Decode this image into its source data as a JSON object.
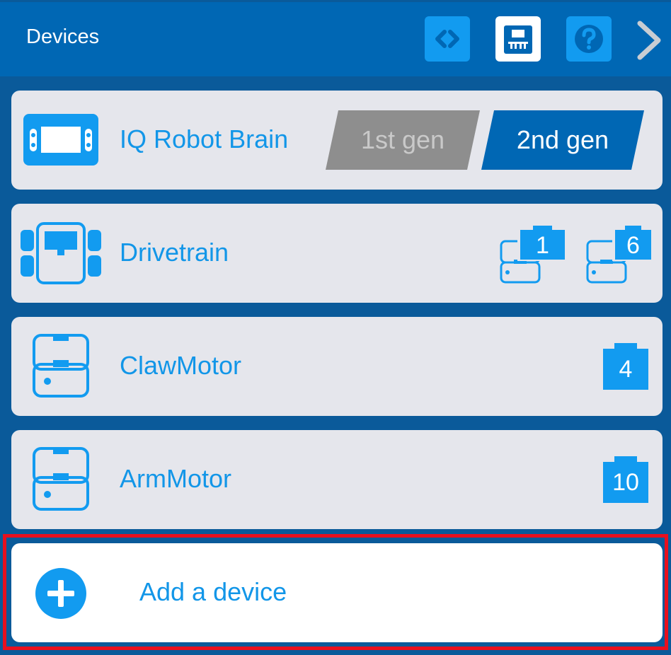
{
  "header": {
    "title": "Devices",
    "buttons": [
      {
        "icon": "code-icon",
        "active": false
      },
      {
        "icon": "devices-icon",
        "active": true
      },
      {
        "icon": "help-icon",
        "active": false
      }
    ],
    "next_icon": "chevron-right-icon"
  },
  "devices": [
    {
      "label": "IQ Robot Brain",
      "icon": "brain-icon",
      "generation": {
        "options": [
          "1st gen",
          "2nd gen"
        ],
        "selected": "2nd gen"
      }
    },
    {
      "label": "Drivetrain",
      "icon": "drivetrain-icon",
      "ports": [
        "1",
        "6"
      ]
    },
    {
      "label": "ClawMotor",
      "icon": "motor-icon",
      "ports": [
        "4"
      ]
    },
    {
      "label": "ArmMotor",
      "icon": "motor-icon",
      "ports": [
        "10"
      ]
    }
  ],
  "add_device": {
    "label": "Add a device",
    "icon": "plus-circle-icon"
  },
  "colors": {
    "header": "#0067b4",
    "background": "#0a5a9a",
    "accent": "#129bf0",
    "label": "#1296e8",
    "highlight": "#e8101e"
  }
}
